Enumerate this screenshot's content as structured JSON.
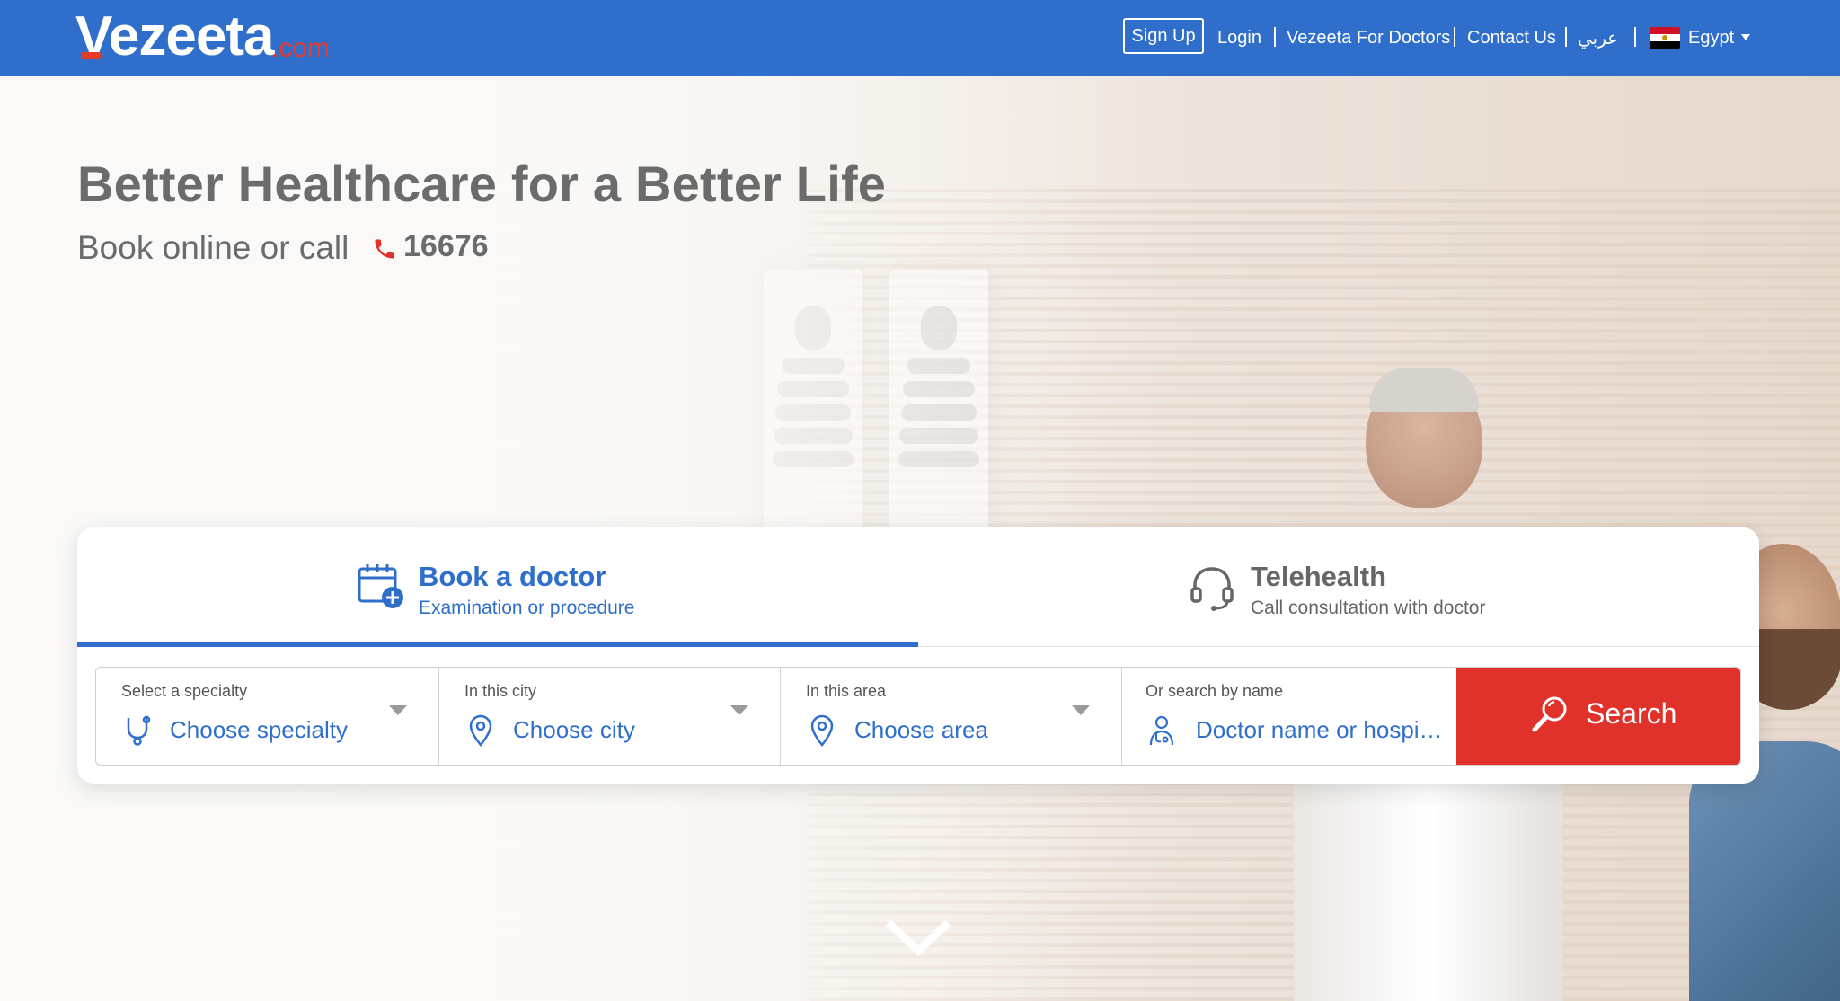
{
  "brand": {
    "name": "Vezeeta",
    "suffix": ".com",
    "primary_color": "#2f6fcb",
    "accent_color": "#e0322b"
  },
  "nav": {
    "signup": "Sign Up",
    "login": "Login",
    "for_doctors": "Vezeeta For Doctors",
    "contact": "Contact Us",
    "language": "عربي",
    "country": "Egypt",
    "country_icon": "egypt-flag-icon"
  },
  "hero": {
    "title": "Better Healthcare for a Better Life",
    "subtitle": "Book online or call",
    "phone": "16676"
  },
  "tabs": [
    {
      "title": "Book a doctor",
      "description": "Examination or procedure",
      "icon": "calendar-plus-icon",
      "active": true
    },
    {
      "title": "Telehealth",
      "description": "Call consultation with doctor",
      "icon": "headset-icon",
      "active": false
    }
  ],
  "search": {
    "specialty": {
      "label": "Select a specialty",
      "value": "Choose specialty",
      "icon": "stethoscope-icon"
    },
    "city": {
      "label": "In this city",
      "value": "Choose city",
      "icon": "location-pin-icon"
    },
    "area": {
      "label": "In this area",
      "value": "Choose area",
      "icon": "location-pin-icon"
    },
    "name": {
      "label": "Or search by name",
      "value": "Doctor name or hospi…",
      "icon": "doctor-icon"
    },
    "button": "Search"
  }
}
